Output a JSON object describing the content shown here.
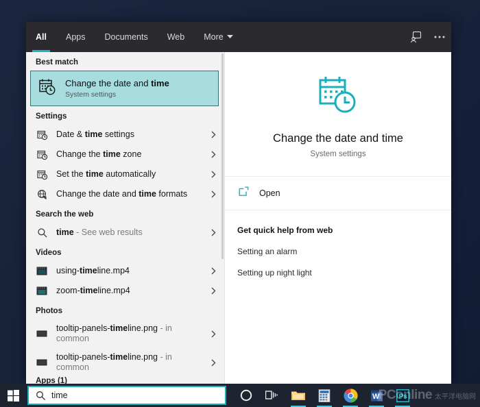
{
  "window": {
    "tabs": [
      {
        "label": "All",
        "active": true,
        "caret": false
      },
      {
        "label": "Apps",
        "active": false,
        "caret": false
      },
      {
        "label": "Documents",
        "active": false,
        "caret": false
      },
      {
        "label": "Web",
        "active": false,
        "caret": false
      },
      {
        "label": "More",
        "active": false,
        "caret": true
      }
    ],
    "header_icons": [
      {
        "name": "feedback-icon",
        "glyph": "⌨"
      },
      {
        "name": "more-options-icon",
        "glyph": "•••"
      }
    ]
  },
  "results": {
    "best_match_header": "Best match",
    "best_match": {
      "title_plain": "Change the date and ",
      "title_bold": "time",
      "subtitle": "System settings",
      "icon": "calendar-clock-icon"
    },
    "settings_header": "Settings",
    "settings_items": [
      {
        "pre": "Date & ",
        "bold": "time",
        "post": " settings",
        "icon": "calendar-clock-small-icon"
      },
      {
        "pre": "Change the ",
        "bold": "time",
        "post": " zone",
        "icon": "calendar-clock-small-icon"
      },
      {
        "pre": "Set the ",
        "bold": "time",
        "post": " automatically",
        "icon": "calendar-clock-small-icon"
      },
      {
        "pre": "Change the date and ",
        "bold": "time",
        "post": " formats",
        "icon": "region-format-icon"
      }
    ],
    "web_header": "Search the web",
    "web_item": {
      "bold": "time",
      "suffix": " - See web results",
      "icon": "search-icon"
    },
    "videos_header": "Videos",
    "video_items": [
      {
        "pre": "using-",
        "bold": "time",
        "post": "line.mp4",
        "icon": "video-file-icon"
      },
      {
        "pre": "zoom-",
        "bold": "time",
        "post": "line.mp4",
        "icon": "video-file-icon"
      }
    ],
    "photos_header": "Photos",
    "photo_items": [
      {
        "pre": "tooltip-panels-",
        "bold": "time",
        "post": "line.png",
        "suffix": " - in",
        "line2": "common",
        "icon": "photo-file-icon"
      },
      {
        "pre": "tooltip-panels-",
        "bold": "time",
        "post": "line.png",
        "suffix": " - in",
        "line2": "common",
        "icon": "photo-file-icon"
      }
    ],
    "cut_off_header": "Apps (1)"
  },
  "detail": {
    "icon": "calendar-clock-large-icon",
    "title": "Change the date and time",
    "subtitle": "System settings",
    "open_label": "Open",
    "open_icon": "open-external-icon",
    "help_title": "Get quick help from web",
    "help_links": [
      "Setting an alarm",
      "Setting up night light"
    ]
  },
  "taskbar": {
    "start_label": "start-button",
    "search_value": "time",
    "icons": [
      {
        "name": "cortana-icon"
      },
      {
        "name": "task-view-icon"
      },
      {
        "name": "file-explorer-icon"
      },
      {
        "name": "calculator-icon"
      },
      {
        "name": "chrome-icon"
      },
      {
        "name": "word-icon"
      },
      {
        "name": "photoshop-icon"
      }
    ],
    "watermark": "PConline",
    "watermark_sub": "太平洋电脑网"
  },
  "colors": {
    "accent_teal": "#22b5bf",
    "highlight_teal": "#a8dde0",
    "tabbar_dark": "#2b2b2f",
    "taskbar_dark": "#1d2430",
    "pane_gray": "#f2f2f2"
  }
}
